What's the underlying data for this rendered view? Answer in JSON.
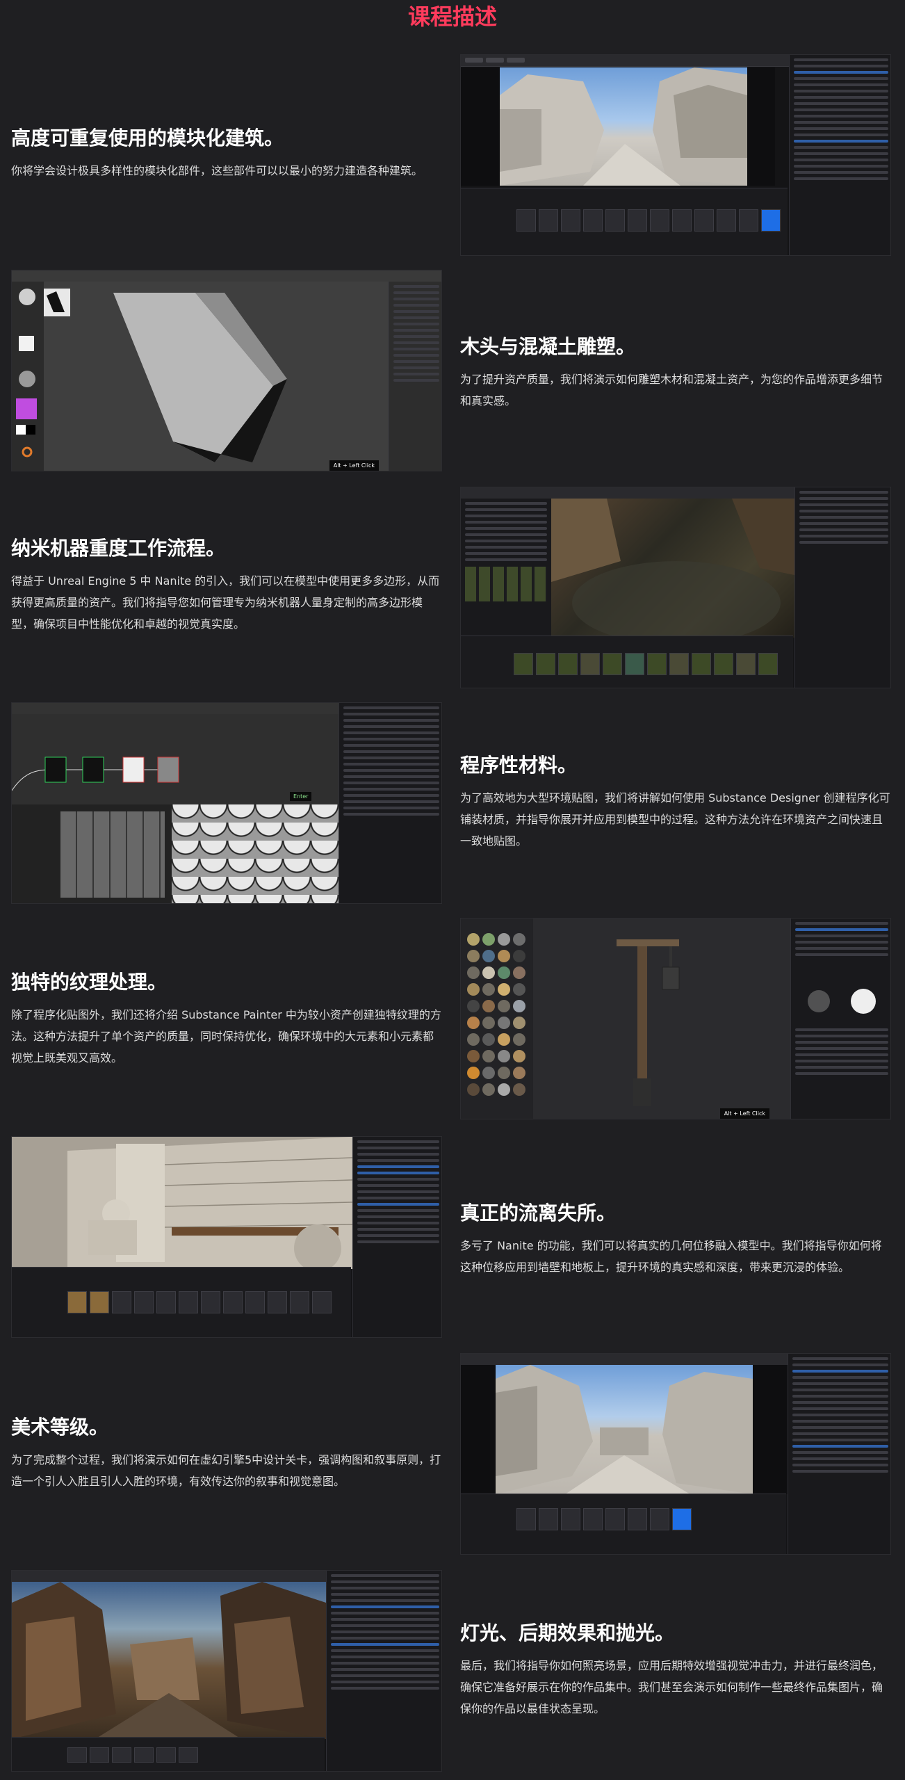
{
  "page": {
    "title": "课程描述"
  },
  "sections": [
    {
      "heading": "高度可重复使用的模块化建筑。",
      "desc": "你将学会设计极具多样性的模块化部件，这些部件可以以最小的努力建造各种建筑。"
    },
    {
      "heading": "木头与混凝土雕塑。",
      "desc": "为了提升资产质量，我们将演示如何雕塑木材和混凝土资产，为您的作品增添更多细节和真实感。"
    },
    {
      "heading": "纳米机器重度工作流程。",
      "desc": "得益于 Unreal Engine 5 中 Nanite 的引入，我们可以在模型中使用更多多边形，从而获得更高质量的资产。我们将指导您如何管理专为纳米机器人量身定制的高多边形模型，确保项目中性能优化和卓越的视觉真实度。"
    },
    {
      "heading": "程序性材料。",
      "desc": "为了高效地为大型环境贴图，我们将讲解如何使用 Substance Designer 创建程序化可铺装材质，并指导你展开并应用到模型中的过程。这种方法允许在环境资产之间快速且一致地贴图。"
    },
    {
      "heading": "独特的纹理处理。",
      "desc": "除了程序化贴图外，我们还将介绍 Substance Painter 中为较小资产创建独特纹理的方法。这种方法提升了单个资产的质量，同时保持优化，确保环境中的大元素和小元素都视觉上既美观又高效。"
    },
    {
      "heading": "真正的流离失所。",
      "desc": "多亏了 Nanite 的功能，我们可以将真实的几何位移融入模型中。我们将指导你如何将这种位移应用到墙壁和地板上，提升环境的真实感和深度，带来更沉浸的体验。"
    },
    {
      "heading": "美术等级。",
      "desc": "为了完成整个过程，我们将演示如何在虚幻引擎5中设计关卡，强调构图和叙事原则，打造一个引人入胜且引人入胜的环境，有效传达你的叙事和视觉意图。"
    },
    {
      "heading": "灯光、后期效果和抛光。",
      "desc": "最后，我们将指导你如何照亮场景，应用后期特效增强视觉冲击力，并进行最终润色，确保它准备好展示在你的作品集中。我们甚至会演示如何制作一些最终作品集图片，确保你的作品以最佳状态呈现。"
    }
  ],
  "screenshots": {
    "zbrush_hint": "Alt + Left Click",
    "designer_enter": "Enter",
    "painter_hint": "Alt + Left Click"
  }
}
